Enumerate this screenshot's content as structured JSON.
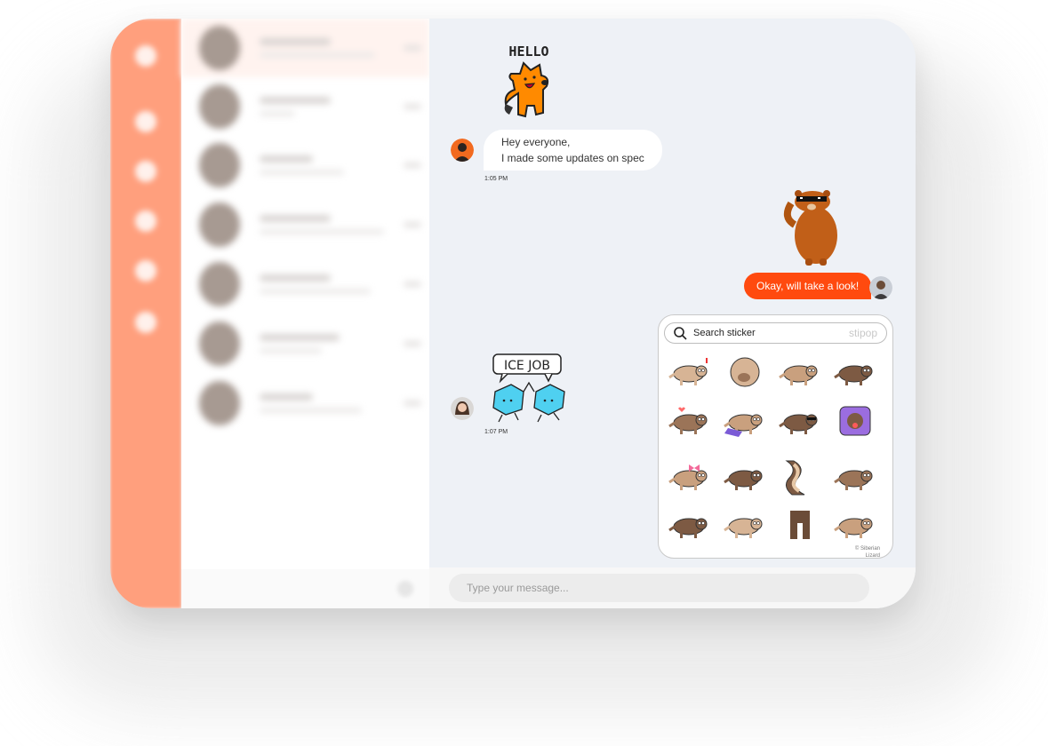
{
  "app": {
    "accent_color": "#ff4a0f",
    "sidebar_color": "#ff9f7d",
    "chat_background": "#eef1f6"
  },
  "sidebar": {
    "icons": [
      "logo-icon",
      "chat-icon",
      "phone-icon",
      "contacts-icon",
      "settings-icon",
      "profile-icon"
    ]
  },
  "conversation_list": {
    "row_count": 7,
    "active_index": 0,
    "note": "content blurred in screenshot"
  },
  "chat": {
    "messages": [
      {
        "type": "sticker",
        "direction": "incoming",
        "sticker_caption": "HELLO",
        "sticker_name": "orange-fox-hello-sticker"
      },
      {
        "type": "text",
        "direction": "incoming",
        "lines": [
          "Hey everyone,",
          "I made some updates on spec"
        ],
        "time": "1:05 PM"
      },
      {
        "type": "sticker",
        "direction": "outgoing",
        "sticker_name": "bear-sunglasses-sticker"
      },
      {
        "type": "text",
        "direction": "outgoing",
        "text": "Okay, will take a look!"
      },
      {
        "type": "sticker",
        "direction": "incoming",
        "sticker_caption": "ICE JOB",
        "sticker_name": "ice-cubes-high-five-sticker",
        "time": "1:07 PM"
      }
    ]
  },
  "sticker_picker": {
    "search_value": "Search sticker",
    "brand": "stipop",
    "credit_line1": "© Siberian",
    "credit_line2": "Lizard",
    "stickers": [
      "ferret-surprised",
      "ferret-curled-ball",
      "ferret-lying",
      "ferret-standing",
      "ferret-heart",
      "ferret-laptop",
      "ferret-sunglasses",
      "ferret-purple-box",
      "ferret-pink-bow",
      "ferret-crouching",
      "ferret-stretched",
      "ferret-crawling",
      "ferret-arched",
      "ferret-rolling",
      "ferret-legs",
      "ferret-sitting"
    ]
  },
  "input": {
    "placeholder": "Type your message..."
  }
}
